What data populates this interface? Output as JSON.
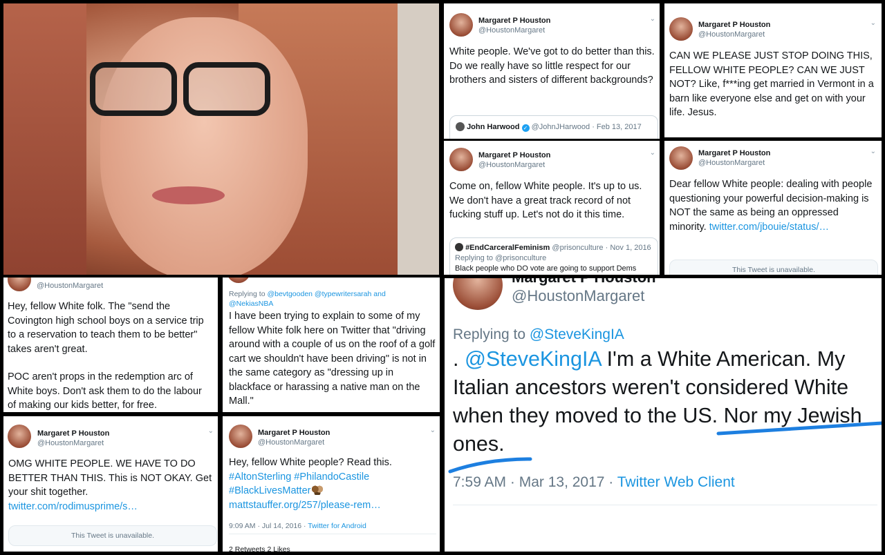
{
  "profile": {
    "name": "Margaret P Houston",
    "handle": "@HoustonMargaret"
  },
  "tweets": {
    "t1": {
      "text": "White people. We've got to do better than this. Do we really have so little respect for our brothers and sisters of different backgrounds?",
      "quote": {
        "name": "John Harwood",
        "handle": "@JohnJHarwood",
        "date": "Feb 13, 2017"
      }
    },
    "t2": {
      "text": "CAN WE PLEASE JUST STOP DOING THIS, FELLOW WHITE PEOPLE? CAN WE JUST NOT? Like, f***ing get married in Vermont in a barn like everyone else and get on with your life. Jesus."
    },
    "t3": {
      "text": "Come on, fellow White people. It's up to us. We don't have a great track record of not fucking stuff up. Let's not do it this time.",
      "quote": {
        "name": "#EndCarceralFeminism",
        "handle": "@prisonculture",
        "date": "Nov 1, 2016",
        "reply": "Replying to @prisonculture",
        "text": "Black people who DO vote are going to support Dems"
      }
    },
    "t4": {
      "text": "Dear fellow White people: dealing with people questioning your powerful decision-making is NOT the same as being an oppressed minority.",
      "link": "twitter.com/jbouie/status/…",
      "unavailable": "This Tweet is unavailable."
    },
    "t5": {
      "text1": "Hey, fellow White folk. The \"send the Covington high school boys on a service trip to a reservation to teach them to be better\" takes aren't great.",
      "text2": "POC aren't props in the redemption arc of White boys. Don't ask them to do the labour of making our kids better, for free."
    },
    "t6": {
      "reply_prefix": "Replying to",
      "reply_to": "@bevtgooden @typewritersarah and @NekiasNBA",
      "text": "I have been trying to explain to some of my fellow White folk here on Twitter that \"driving around with a couple of us on the roof of a golf cart we shouldn't have been driving\" is not in the same category as \"dressing up in blackface or harassing a native man on the Mall.\""
    },
    "t7": {
      "text": "OMG WHITE PEOPLE. WE HAVE TO DO BETTER THAN THIS. This is NOT OKAY. Get your shit together.",
      "link": "twitter.com/rodimusprime/s…",
      "unavailable": "This Tweet is unavailable."
    },
    "t8": {
      "text": "Hey, fellow White people? Read this.",
      "hashtags": "#AltonSterling #PhilandoCastile #BlackLivesMatter",
      "link": "mattstauffer.org/257/please-rem…",
      "time": "9:09 AM · Jul 14, 2016 · ",
      "client": "Twitter for Android",
      "stats": "2 Retweets   2 Likes"
    },
    "t9": {
      "reply_prefix": "Replying to",
      "reply_to": "@SteveKingIA",
      "mention": "@SteveKingIA",
      "text": " I'm a White American. My Italian ancestors weren't considered White when they moved to the US. Nor my Jewish ones.",
      "time": "7:59 AM · Mar 13, 2017 · ",
      "client": "Twitter Web Client"
    }
  },
  "colors": {
    "link": "#1b95e0",
    "text": "#14171a",
    "muted": "#657786",
    "underline": "#1d7fe0"
  }
}
